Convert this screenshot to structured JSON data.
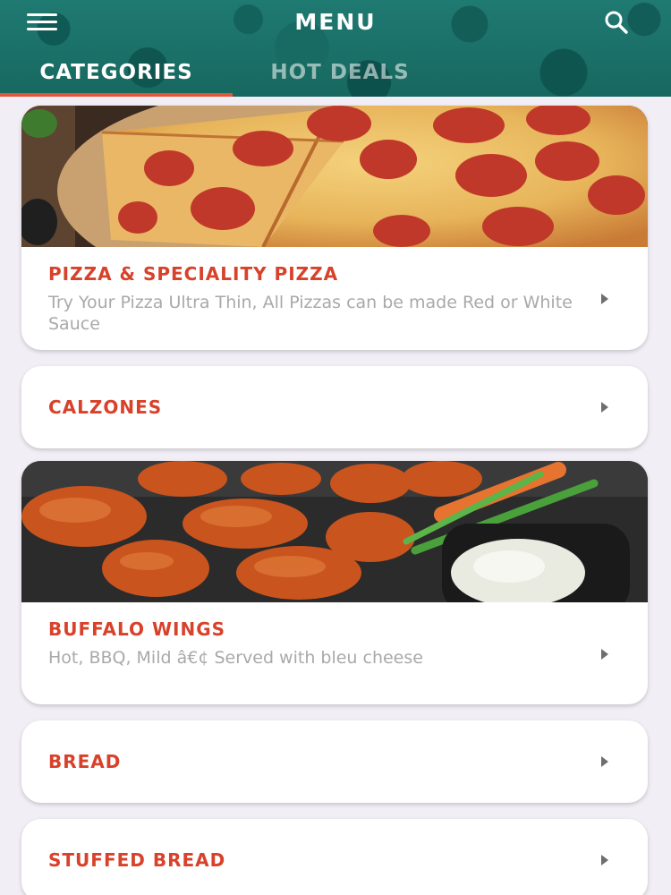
{
  "header": {
    "title": "MENU",
    "tabs": [
      {
        "label": "CATEGORIES",
        "active": true
      },
      {
        "label": "HOT DEALS",
        "active": false
      }
    ],
    "icons": {
      "menu": "hamburger-menu-icon",
      "search": "search-icon"
    },
    "colors": {
      "header_bg": "#1f7a72",
      "tab_indicator": "#e2553b"
    }
  },
  "categories": [
    {
      "title": "PIZZA & SPECIALITY PIZZA",
      "description": "Try Your Pizza Ultra Thin, All Pizzas can be made Red or White Sauce",
      "image": "pepperoni-pizza-photo"
    },
    {
      "title": "CALZONES"
    },
    {
      "title": "BUFFALO WINGS",
      "description": "Hot, BBQ, Mild â€¢ Served with bleu cheese",
      "image": "buffalo-wings-photo"
    },
    {
      "title": "BREAD"
    },
    {
      "title": "STUFFED BREAD"
    }
  ],
  "colors": {
    "category_title": "#d8412a",
    "description": "#a9a9a9",
    "page_bg": "#f1eef5"
  }
}
